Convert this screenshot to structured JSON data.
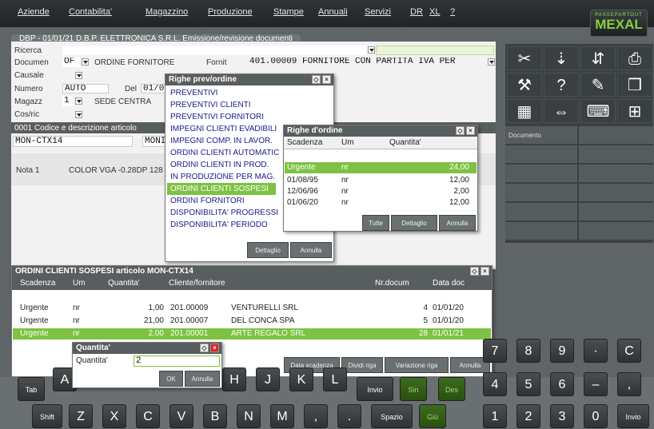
{
  "menu": {
    "items": [
      "Aziende",
      "Contabilita'",
      "Magazzino",
      "Produzione",
      "Stampe",
      "Annuali",
      "Servizi",
      "DR",
      "XL",
      "?"
    ],
    "logo_top": "PASSEPARTOUT",
    "logo_name": "MEXAL"
  },
  "doc_tab": "DBP - 01/01/21  D.B.P. ELETTRONICA S.R.L.  Emissione/revisione documenti",
  "form": {
    "ricerca_label": "Ricerca",
    "documen_label": "Documen",
    "documen_code": "OF",
    "documen_desc": "ORDINE FORNITORE",
    "fornit_label": "Fornit",
    "fornit_value": "401.00009 FORNITORE CON PARTITA IVA PER",
    "causale_label": "Causale",
    "numero_label": "Numero",
    "numero_value": "AUTO",
    "del_label": "Del",
    "del_value": "01/0",
    "magazz_label": "Magazz",
    "magazz_value": "1",
    "magazz_desc": "SEDE CENTRA",
    "cosric_label": "Cos/ric",
    "art_header": "0001   Codice e descrizione articolo",
    "art_code": "MON-CTX14",
    "art_desc_short": "MONI",
    "nota_label": "Nota 1",
    "nota_value": "COLOR VGA -0.28DP 128"
  },
  "righe_menu": {
    "title": "Righe prev/ordine",
    "items": [
      "PREVENTIVI",
      "PREVENTIVI CLIENTI",
      "PREVENTIVI FORNITORI",
      "IMPEGNI CLIENTI EVADIBILI",
      "IMPEGNI COMP. IN LAVOR.",
      "ORDINI CLIENTI AUTOMATIC",
      "ORDINI CLIENTI IN PROD.",
      "IN PRODUZIONE PER MAG.",
      "ORDINI CLIENTI SOSPESI",
      "ORDINI FORNITORI",
      "DISPONIBILITA' PROGRESSI",
      "DISPONIBILITA' PERIODO"
    ],
    "selected_index": 8,
    "dettaglio": "Dettaglio",
    "annulla": "Annulla"
  },
  "righe_ordine": {
    "title": "Righe d'ordine",
    "headers": [
      "Scadenza",
      "Um",
      "Quantita'"
    ],
    "rows": [
      [
        "Urgente",
        "nr",
        "24,00"
      ],
      [
        "01/08/95",
        "nr",
        "12,00"
      ],
      [
        "12/06/96",
        "nr",
        "2,00"
      ],
      [
        "01/06/20",
        "nr",
        "12,00"
      ]
    ],
    "selected_index": 0,
    "tutte": "Tutte",
    "dettaglio": "Dettaglio",
    "annulla": "Annulla"
  },
  "sospesi": {
    "title": "ORDINI CLIENTI SOSPESI articolo MON-CTX14",
    "headers": [
      "Scadenza",
      "Um",
      "Quantita'",
      "Cliente/fornitore",
      "Nr.docum",
      "Data doc"
    ],
    "rows": [
      [
        "Urgente",
        "nr",
        "1,00",
        "201.00009",
        "VENTURELLI SRL",
        "4",
        "01/01/20"
      ],
      [
        "Urgente",
        "nr",
        "21,00",
        "201.00007",
        "DEL CONCA SPA",
        "5",
        "01/01/20"
      ],
      [
        "Urgente",
        "nr",
        "2,00",
        "201.00001",
        "ARTE REGALO SRL",
        "28",
        "01/01/21"
      ]
    ],
    "selected_index": 2,
    "buttons": [
      "Data scadenza",
      "Dividi riga",
      "Variazione riga",
      "Annulla"
    ]
  },
  "quantita": {
    "title": "Quantita'",
    "label": "Quantita'",
    "value": "2",
    "ok": "OK",
    "annulla": "Annulla"
  },
  "toolbar": {
    "icons": [
      "scissors-icon",
      "document-arrow-icon",
      "import-icon",
      "printer-icon",
      "wrench-icon",
      "help-icon",
      "edit-icon",
      "open-box-icon",
      "calculator-icon",
      "fit-width-icon",
      "keyboard-icon",
      "grid-icon"
    ],
    "glyphs": [
      "✂",
      "⇣",
      "⇵",
      "⎙",
      "⚒",
      "?",
      "✎",
      "❒",
      "▦",
      "⇔",
      "⌨",
      "⊞"
    ],
    "documento": "Documento"
  },
  "keyboard": {
    "row1": [
      "Tab",
      "A",
      "H",
      "J",
      "K",
      "L",
      "Invio",
      "Sin",
      "Des"
    ],
    "row2": [
      "Shift",
      "Z",
      "X",
      "C",
      "V",
      "B",
      "N",
      "M",
      ",",
      ".",
      "Spazio",
      "Giù"
    ],
    "num1": [
      "7",
      "8",
      "9",
      "·",
      "C"
    ],
    "num2": [
      "4",
      "5",
      "6",
      "–",
      ","
    ],
    "num3": [
      "1",
      "2",
      "3",
      "0",
      "Invio"
    ]
  },
  "colors": {
    "accent_green": "#7dc242",
    "title_bar": "#585d5f",
    "link_blue": "#1a1a8c"
  }
}
